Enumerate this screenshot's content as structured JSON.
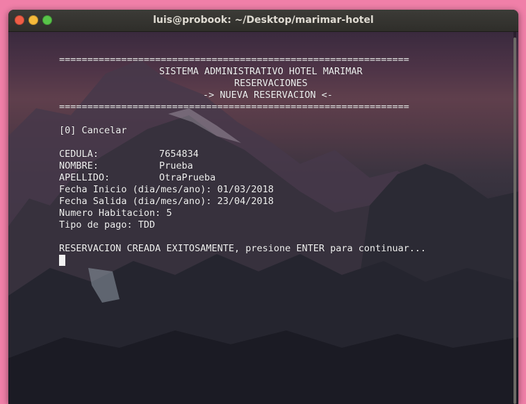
{
  "window": {
    "title": "luis@probook: ~/Desktop/marimar-hotel"
  },
  "terminal": {
    "separator_top": "==============================================================",
    "header_line1": "SISTEMA ADMINISTRATIVO HOTEL MARIMAR",
    "header_line2": "RESERVACIONES",
    "header_line3": "-> NUEVA RESERVACION <-",
    "separator_bottom": "==============================================================",
    "cancel_option": "[0] Cancelar",
    "fields": [
      {
        "label": "CEDULA:",
        "value": "7654834"
      },
      {
        "label": "NOMBRE:",
        "value": "Prueba"
      },
      {
        "label": "APELLIDO:",
        "value": "OtraPrueba"
      }
    ],
    "fecha_inicio": "Fecha Inicio (dia/mes/ano): 01/03/2018",
    "fecha_salida": "Fecha Salida (dia/mes/ano): 23/04/2018",
    "habitacion": "Numero Habitacion: 5",
    "tipo_pago": "Tipo de pago: TDD",
    "status_message": "RESERVACION CREADA EXITOSAMENTE, presione ENTER para continuar..."
  },
  "colors": {
    "background_pink": "#f07fa8",
    "titlebar": "#3c3b37",
    "close_button": "#ef5d46",
    "minimize_button": "#f5b93b",
    "maximize_button": "#58c449",
    "terminal_text": "#f2f2f2"
  }
}
